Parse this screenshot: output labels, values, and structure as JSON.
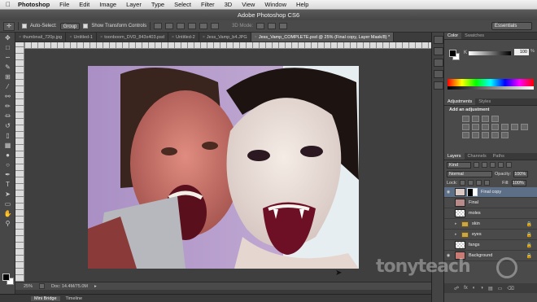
{
  "menubar": {
    "app": "Photoshop",
    "items": [
      "File",
      "Edit",
      "Image",
      "Layer",
      "Type",
      "Select",
      "Filter",
      "3D",
      "View",
      "Window",
      "Help"
    ]
  },
  "window_title": "Adobe Photoshop CS6",
  "options": {
    "auto_select_label": "Auto-Select:",
    "auto_select_value": "Group",
    "transform_label": "Show Transform Controls",
    "mode3d": "3D Mode:",
    "workspace": "Essentials"
  },
  "tabs": [
    {
      "label": "thumbnail_720p.jpg",
      "active": false
    },
    {
      "label": "Untitled-1",
      "active": false
    },
    {
      "label": "toonboom_DVD_843x403.psd",
      "active": false
    },
    {
      "label": "Untitled-2",
      "active": false
    },
    {
      "label": "Jess_Vamp_b4.JPG",
      "active": false
    },
    {
      "label": "Jess_Vamp_COMPLETE.psd @ 25% (Final copy, Layer Mask/8) *",
      "active": true
    }
  ],
  "status": {
    "zoom": "25%",
    "doc": "Doc: 14.4M/75.0M"
  },
  "bottom_tabs": [
    "Mini Bridge",
    "Timeline"
  ],
  "color_panel": {
    "tabs": [
      "Color",
      "Swatches"
    ],
    "channel": "K",
    "value": "100",
    "unit": "%"
  },
  "adjustments_panel": {
    "tabs": [
      "Adjustments",
      "Styles"
    ],
    "title": "Add an adjustment"
  },
  "layers_panel": {
    "tabs": [
      "Layers",
      "Channels",
      "Paths"
    ],
    "kind": "Kind",
    "blend_mode": "Normal",
    "opacity_label": "Opacity:",
    "opacity": "100%",
    "lock_label": "Lock:",
    "fill_label": "Fill:",
    "fill": "100%",
    "layers": [
      {
        "name": "Final copy",
        "visible": true,
        "selected": true,
        "type": "pixel-mask",
        "locked": false
      },
      {
        "name": "Final",
        "visible": false,
        "selected": false,
        "type": "pixel",
        "locked": false
      },
      {
        "name": "moles",
        "visible": false,
        "selected": false,
        "type": "empty",
        "locked": false
      },
      {
        "name": "skin",
        "visible": false,
        "selected": false,
        "type": "folder",
        "locked": true
      },
      {
        "name": "eyes",
        "visible": false,
        "selected": false,
        "type": "folder",
        "locked": true
      },
      {
        "name": "fangs",
        "visible": false,
        "selected": false,
        "type": "empty",
        "locked": true
      },
      {
        "name": "Background",
        "visible": true,
        "selected": false,
        "type": "pixel",
        "locked": true
      }
    ]
  },
  "watermark": "tonyteach",
  "colors": {
    "panel_bg": "#4a4a4a",
    "selected_layer": "#5d6f86",
    "canvas_bg": "#3f3f3f"
  }
}
